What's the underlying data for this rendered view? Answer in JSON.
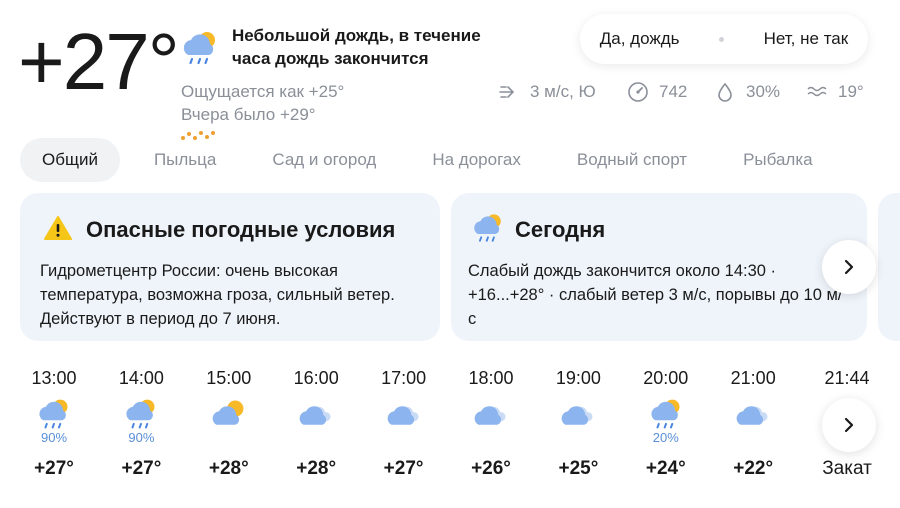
{
  "current": {
    "temperature": "+27°",
    "condition": "Небольшой дождь, в течение часа дождь закончится",
    "feels_like": "Ощущается как +25°",
    "yesterday": "Вчера было +29°"
  },
  "confirm": {
    "yes": "Да, дождь",
    "no": "Нет, не так"
  },
  "stats": {
    "wind": "3 м/с, Ю",
    "pressure": "742",
    "humidity": "30%",
    "water": "19°"
  },
  "tabs": [
    "Общий",
    "Пыльца",
    "Сад и огород",
    "На дорогах",
    "Водный спорт",
    "Рыбалка"
  ],
  "cards": {
    "warning": {
      "title": "Опасные погодные условия",
      "body": "Гидрометцентр России: очень высокая температура, возможна гроза, сильный ветер. Действуют в период до 7 июня."
    },
    "today": {
      "title": "Сегодня",
      "body": "Слабый дождь закончится около 14:30 · +16...+28° · слабый ветер 3 м/с, порывы до 10 м/с"
    }
  },
  "hourly": [
    {
      "time": "13:00",
      "icon": "rain-sun-cloud-icon",
      "prob": "90%",
      "temp": "+27°"
    },
    {
      "time": "14:00",
      "icon": "rain-sun-cloud-icon",
      "prob": "90%",
      "temp": "+27°"
    },
    {
      "time": "15:00",
      "icon": "sun-cloud-icon",
      "prob": "",
      "temp": "+28°"
    },
    {
      "time": "16:00",
      "icon": "cloud-icon",
      "prob": "",
      "temp": "+28°"
    },
    {
      "time": "17:00",
      "icon": "cloud-icon",
      "prob": "",
      "temp": "+27°"
    },
    {
      "time": "18:00",
      "icon": "cloud-icon",
      "prob": "",
      "temp": "+26°"
    },
    {
      "time": "19:00",
      "icon": "cloud-icon",
      "prob": "",
      "temp": "+25°"
    },
    {
      "time": "20:00",
      "icon": "rain-sun-cloud-icon",
      "prob": "20%",
      "temp": "+24°"
    },
    {
      "time": "21:00",
      "icon": "cloud-icon",
      "prob": "",
      "temp": "+22°"
    }
  ],
  "sunset": {
    "time": "21:44",
    "label": "Закат"
  },
  "colors": {
    "accent": "#5a8fd8",
    "card_bg": "#eef4fa",
    "sun": "#f7b928",
    "warning": "#f5c518"
  }
}
